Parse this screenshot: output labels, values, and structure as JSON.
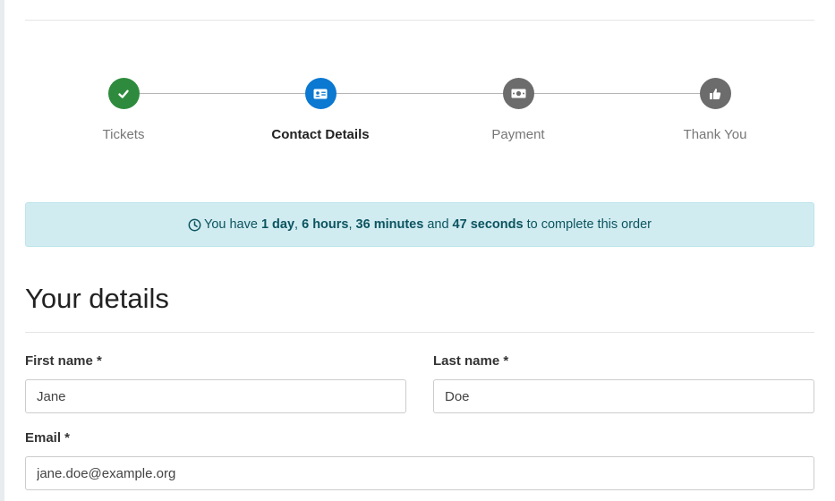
{
  "stepper": {
    "steps": [
      {
        "label": "Tickets",
        "icon": "check-icon",
        "state": "complete",
        "color": "#2e8b3d"
      },
      {
        "label": "Contact Details",
        "icon": "id-card-icon",
        "state": "active",
        "color": "#0b78d1"
      },
      {
        "label": "Payment",
        "icon": "money-bill-icon",
        "state": "pending",
        "color": "#6c6c6c"
      },
      {
        "label": "Thank You",
        "icon": "thumbs-up-icon",
        "state": "pending",
        "color": "#6c6c6c"
      }
    ]
  },
  "alert": {
    "icon": "clock-icon",
    "prefix": "You have ",
    "days": "1 day",
    "sep1": ", ",
    "hours": "6 hours",
    "sep2": ", ",
    "minutes": "36 minutes",
    "and": " and ",
    "seconds": "47 seconds",
    "suffix": " to complete this order",
    "background": "#d1ecf1",
    "text_color": "#0c5460"
  },
  "details": {
    "title": "Your details",
    "first_name": {
      "label": "First name *",
      "value": "Jane"
    },
    "last_name": {
      "label": "Last name *",
      "value": "Doe"
    },
    "email": {
      "label": "Email *",
      "value": "jane.doe@example.org"
    }
  }
}
